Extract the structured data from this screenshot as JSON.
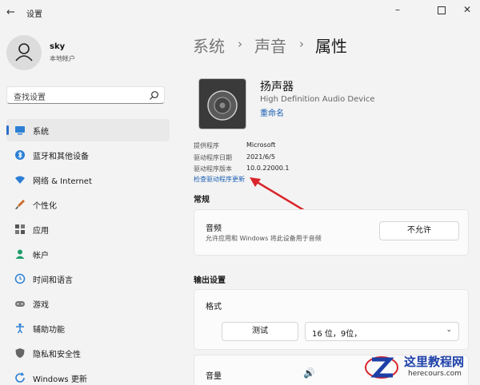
{
  "window": {
    "title": "设置",
    "back_icon": "back-arrow-icon",
    "minimize_icon": "minimize-icon",
    "maximize_icon": "maximize-icon",
    "close_icon": "close-icon"
  },
  "user": {
    "name": "sky",
    "account_type": "本地帐户"
  },
  "search": {
    "placeholder": "查找设置"
  },
  "sidebar": {
    "items": [
      {
        "label": "系统",
        "icon": "system-display-icon",
        "active": true
      },
      {
        "label": "蓝牙和其他设备",
        "icon": "bluetooth-icon"
      },
      {
        "label": "网络 & Internet",
        "icon": "wifi-icon"
      },
      {
        "label": "个性化",
        "icon": "brush-icon"
      },
      {
        "label": "应用",
        "icon": "apps-icon"
      },
      {
        "label": "帐户",
        "icon": "account-icon"
      },
      {
        "label": "时间和语言",
        "icon": "globe-clock-icon"
      },
      {
        "label": "游戏",
        "icon": "gamepad-icon"
      },
      {
        "label": "辅助功能",
        "icon": "accessibility-icon"
      },
      {
        "label": "隐私和安全性",
        "icon": "shield-icon"
      },
      {
        "label": "Windows 更新",
        "icon": "update-icon"
      }
    ]
  },
  "breadcrumb": {
    "items": [
      "系统",
      "声音",
      "属性"
    ],
    "separator": "›"
  },
  "device": {
    "name": "扬声器",
    "subtitle": "High Definition Audio Device",
    "rename_link": "重命名",
    "info": [
      {
        "key": "提供程序",
        "value": "Microsoft"
      },
      {
        "key": "驱动程序日期",
        "value": "2021/6/5"
      },
      {
        "key": "驱动程序版本",
        "value": "10.0.22000.1"
      }
    ],
    "check_update_link": "检查驱动程序更新"
  },
  "general": {
    "heading": "常规",
    "audio": {
      "title": "音频",
      "description": "允许应用和 Windows 将此设备用于音频",
      "button": "不允许"
    }
  },
  "output": {
    "heading": "输出设置",
    "format": {
      "title": "格式",
      "test_button": "测试",
      "selected": "16 位，9位，"
    },
    "volume": {
      "title": "音量"
    }
  },
  "watermark": {
    "line1": "这里教程网",
    "line2": "herecours.com"
  },
  "colors": {
    "accent": "#2b6fc6",
    "link": "#1a5fb4",
    "arrow": "#d9252b"
  }
}
